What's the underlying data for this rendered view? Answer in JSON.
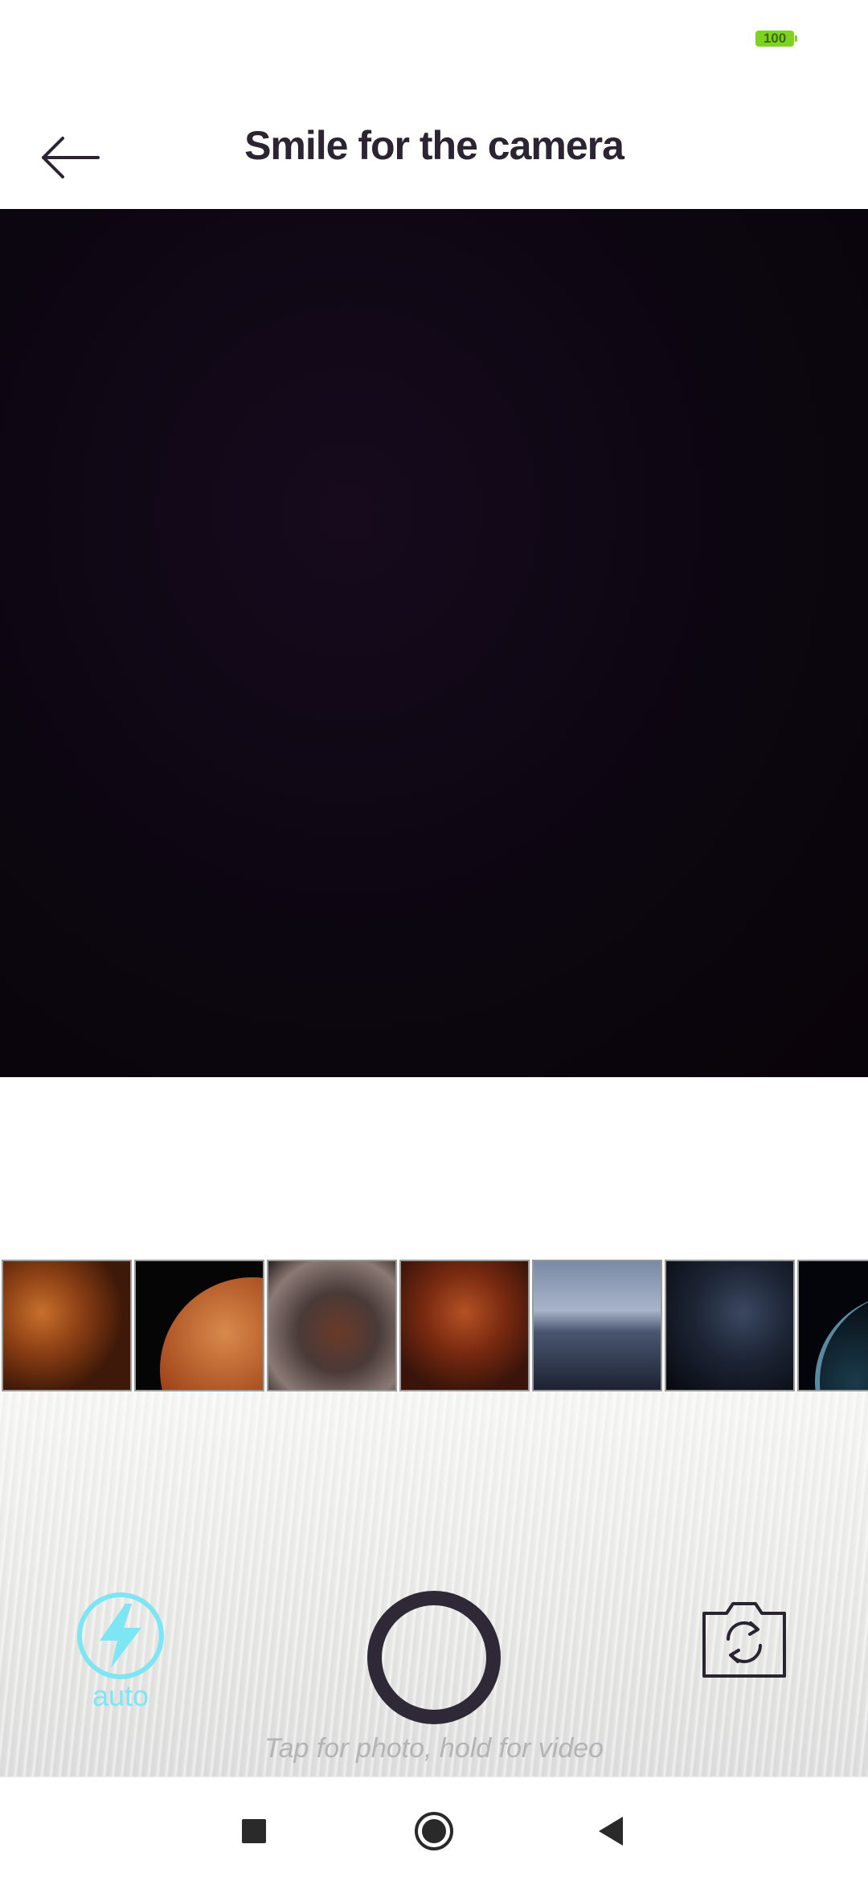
{
  "status_bar": {
    "battery_level": "100",
    "battery_color": "#7ed321"
  },
  "header": {
    "title": "Smile for the camera",
    "back_icon": "arrow-left-icon"
  },
  "camera_preview": {
    "background_color": "#0b0610"
  },
  "gallery": {
    "thumbnails": [
      {
        "name": "gallery-thumb-1"
      },
      {
        "name": "gallery-thumb-2"
      },
      {
        "name": "gallery-thumb-3"
      },
      {
        "name": "gallery-thumb-4"
      },
      {
        "name": "gallery-thumb-5"
      },
      {
        "name": "gallery-thumb-6"
      },
      {
        "name": "gallery-thumb-7"
      }
    ]
  },
  "controls": {
    "flash_icon": "lightning-bolt-icon",
    "flash_mode": "auto",
    "flash_color": "#7ee6f2",
    "shutter_icon": "shutter-ring-icon",
    "shutter_color": "#2f2836",
    "switch_camera_icon": "camera-switch-icon",
    "hint": "Tap for photo, hold for video"
  },
  "nav_bar": {
    "recents_icon": "square-icon",
    "home_icon": "circle-icon",
    "back_icon": "triangle-back-icon"
  }
}
